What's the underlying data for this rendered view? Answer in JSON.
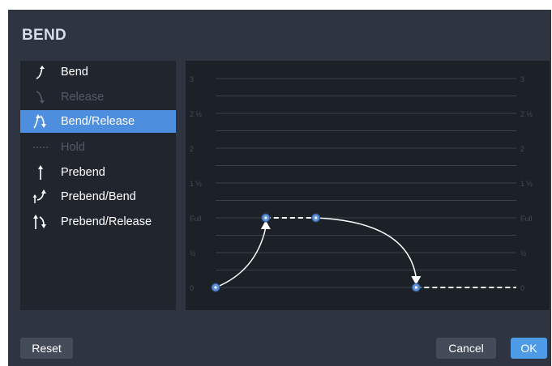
{
  "dialog": {
    "title": "BEND"
  },
  "bend_types": [
    {
      "label": "Bend",
      "icon": "bend-icon",
      "enabled": true,
      "selected": false
    },
    {
      "label": "Release",
      "icon": "release-icon",
      "enabled": false,
      "selected": false
    },
    {
      "label": "Bend/Release",
      "icon": "bend-release-icon",
      "enabled": true,
      "selected": true
    },
    {
      "label": "Hold",
      "icon": "hold-icon",
      "enabled": false,
      "selected": false
    },
    {
      "label": "Prebend",
      "icon": "prebend-icon",
      "enabled": true,
      "selected": false
    },
    {
      "label": "Prebend/Bend",
      "icon": "prebend-bend-icon",
      "enabled": true,
      "selected": false
    },
    {
      "label": "Prebend/Release",
      "icon": "prebend-release-icon",
      "enabled": true,
      "selected": false
    }
  ],
  "graph": {
    "pitch_labels": [
      "0",
      "½",
      "Full",
      "1 ½",
      "2",
      "2 ½",
      "3"
    ],
    "points": [
      {
        "time": 0,
        "pitch": 0
      },
      {
        "time": 1,
        "pitch": 1
      },
      {
        "time": 2,
        "pitch": 1
      },
      {
        "time": 4,
        "pitch": 0
      }
    ],
    "time_max": 6,
    "pitch_max": 3,
    "colors": {
      "grid": "#3b414b",
      "curve": "#ffffff",
      "point": "#5b8fd6",
      "label": "#454b55"
    }
  },
  "buttons": {
    "reset": "Reset",
    "cancel": "Cancel",
    "ok": "OK"
  }
}
